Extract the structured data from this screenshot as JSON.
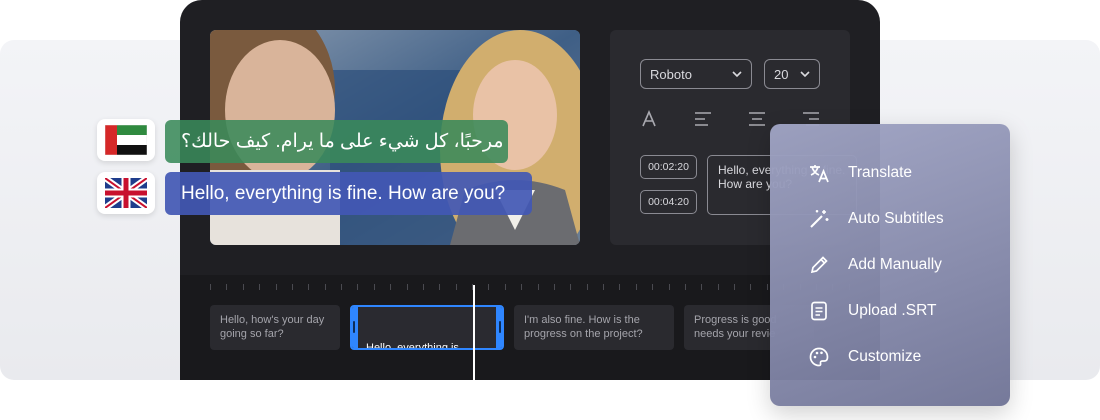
{
  "editor": {
    "font_family": "Roboto",
    "font_size": "20",
    "timestamps": [
      "00:02:20",
      "00:04:20"
    ],
    "subtitle_preview": "Hello, everything is fine. How are you?"
  },
  "captions": {
    "arabic": "مرحبًا، كل شيء على ما يرام. كيف حالك؟",
    "english": "Hello, everything is fine. How are you?"
  },
  "timeline": {
    "clips": [
      "Hello, how's your day\ngoing so far?",
      "Hello, everything is\nfine. How are you?",
      "I'm also fine. How is the\nprogress on the project?",
      "Progress is good\nneeds your revie"
    ]
  },
  "menu": {
    "items": [
      {
        "label": "Translate",
        "icon": "translate-icon"
      },
      {
        "label": "Auto Subtitles",
        "icon": "magic-wand-icon"
      },
      {
        "label": "Add Manually",
        "icon": "pencil-icon"
      },
      {
        "label": "Upload .SRT",
        "icon": "document-icon"
      },
      {
        "label": "Customize",
        "icon": "palette-icon"
      }
    ]
  },
  "colors": {
    "accent": "#2f86ff",
    "arabic_bubble": "#3a8a5a",
    "english_bubble": "#4258b4",
    "device": "#1f1f23"
  }
}
